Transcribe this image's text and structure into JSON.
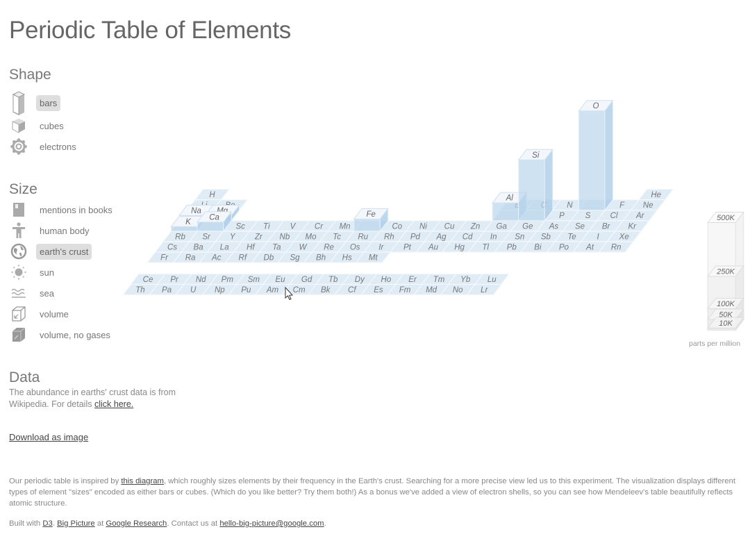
{
  "title": "Periodic Table of Elements",
  "shape": {
    "heading": "Shape",
    "options": [
      {
        "label": "bars",
        "icon": "bar-icon",
        "selected": true
      },
      {
        "label": "cubes",
        "icon": "cube-icon",
        "selected": false
      },
      {
        "label": "electrons",
        "icon": "electrons-icon",
        "selected": false
      }
    ]
  },
  "size": {
    "heading": "Size",
    "options": [
      {
        "label": "mentions in books",
        "icon": "book-icon",
        "selected": false
      },
      {
        "label": "human body",
        "icon": "human-icon",
        "selected": false
      },
      {
        "label": "earth's crust",
        "icon": "globe-icon",
        "selected": true
      },
      {
        "label": "sun",
        "icon": "sun-icon",
        "selected": false
      },
      {
        "label": "sea",
        "icon": "waves-icon",
        "selected": false
      },
      {
        "label": "volume",
        "icon": "volume-icon",
        "selected": false
      },
      {
        "label": "volume, no gases",
        "icon": "volume-solid-icon",
        "selected": false
      }
    ]
  },
  "data_section": {
    "heading": "Data",
    "text": "The abundance in earths' crust data is from Wikipedia. For details",
    "link": "click here."
  },
  "download_label": "Download as image",
  "about": {
    "pre": "Our periodic table is inspired by ",
    "link": "this diagram",
    "post": ", which roughly sizes elements by their frequency in the Earth's crust. Searching for a more precise view led us to this experiment. The visualization displays different types of element \"sizes\" encoded as either bars or cubes. (Which do you like better? Try them both!) As a bonus we've added a view of electron shells, so you can see how Mendeleev's table beautifully reflects atomic structure."
  },
  "built": {
    "t1": "Built with ",
    "d3": "D3",
    "t2": ". ",
    "bp": "Big Picture",
    "t3": " at ",
    "gr": "Google Research",
    "t4": ". Contact us at ",
    "email": "hello-big-picture@google.com",
    "t5": "."
  },
  "table": {
    "periods": [
      [
        "H",
        "He"
      ],
      [
        "Li",
        "Be",
        "B",
        "C",
        "N",
        "O",
        "F",
        "Ne"
      ],
      [
        "Na",
        "Mg",
        "Al",
        "Si",
        "P",
        "S",
        "Cl",
        "Ar"
      ],
      [
        "K",
        "Ca",
        "Sc",
        "Ti",
        "V",
        "Cr",
        "Mn",
        "Fe",
        "Co",
        "Ni",
        "Cu",
        "Zn",
        "Ga",
        "Ge",
        "As",
        "Se",
        "Br",
        "Kr"
      ],
      [
        "Rb",
        "Sr",
        "Y",
        "Zr",
        "Nb",
        "Mo",
        "Tc",
        "Ru",
        "Rh",
        "Pd",
        "Ag",
        "Cd",
        "In",
        "Sn",
        "Sb",
        "Te",
        "I",
        "Xe"
      ],
      [
        "Cs",
        "Ba",
        "La",
        "Hf",
        "Ta",
        "W",
        "Re",
        "Os",
        "Ir",
        "Pt",
        "Au",
        "Hg",
        "Tl",
        "Pb",
        "Bi",
        "Po",
        "At",
        "Rn"
      ],
      [
        "Fr",
        "Ra",
        "Ac",
        "Rf",
        "Db",
        "Sg",
        "Bh",
        "Hs",
        "Mt"
      ]
    ],
    "lanthanides": [
      "Ce",
      "Pr",
      "Nd",
      "Pm",
      "Sm",
      "Eu",
      "Gd",
      "Tb",
      "Dy",
      "Ho",
      "Er",
      "Tm",
      "Yb",
      "Lu"
    ],
    "actinides": [
      "Th",
      "Pa",
      "U",
      "Np",
      "Pu",
      "Am",
      "Cm",
      "Bk",
      "Cf",
      "Es",
      "Fm",
      "Md",
      "No",
      "Lr"
    ],
    "abundance_ppm": {
      "O": 461000,
      "Si": 282000,
      "Al": 82300,
      "Fe": 56300,
      "Ca": 41500,
      "Na": 23600,
      "Mg": 23300,
      "K": 20900
    }
  },
  "scale": {
    "ticks": [
      {
        "label": "10K",
        "value": 10000
      },
      {
        "label": "50K",
        "value": 50000
      },
      {
        "label": "100K",
        "value": 100000
      },
      {
        "label": "250K",
        "value": 250000
      },
      {
        "label": "500K",
        "value": 500000
      }
    ],
    "unit": "parts per million"
  },
  "colors": {
    "cell": "#dfebf5",
    "bar": "#b9d5ec",
    "text": "#777777",
    "selected": "#dedede"
  }
}
